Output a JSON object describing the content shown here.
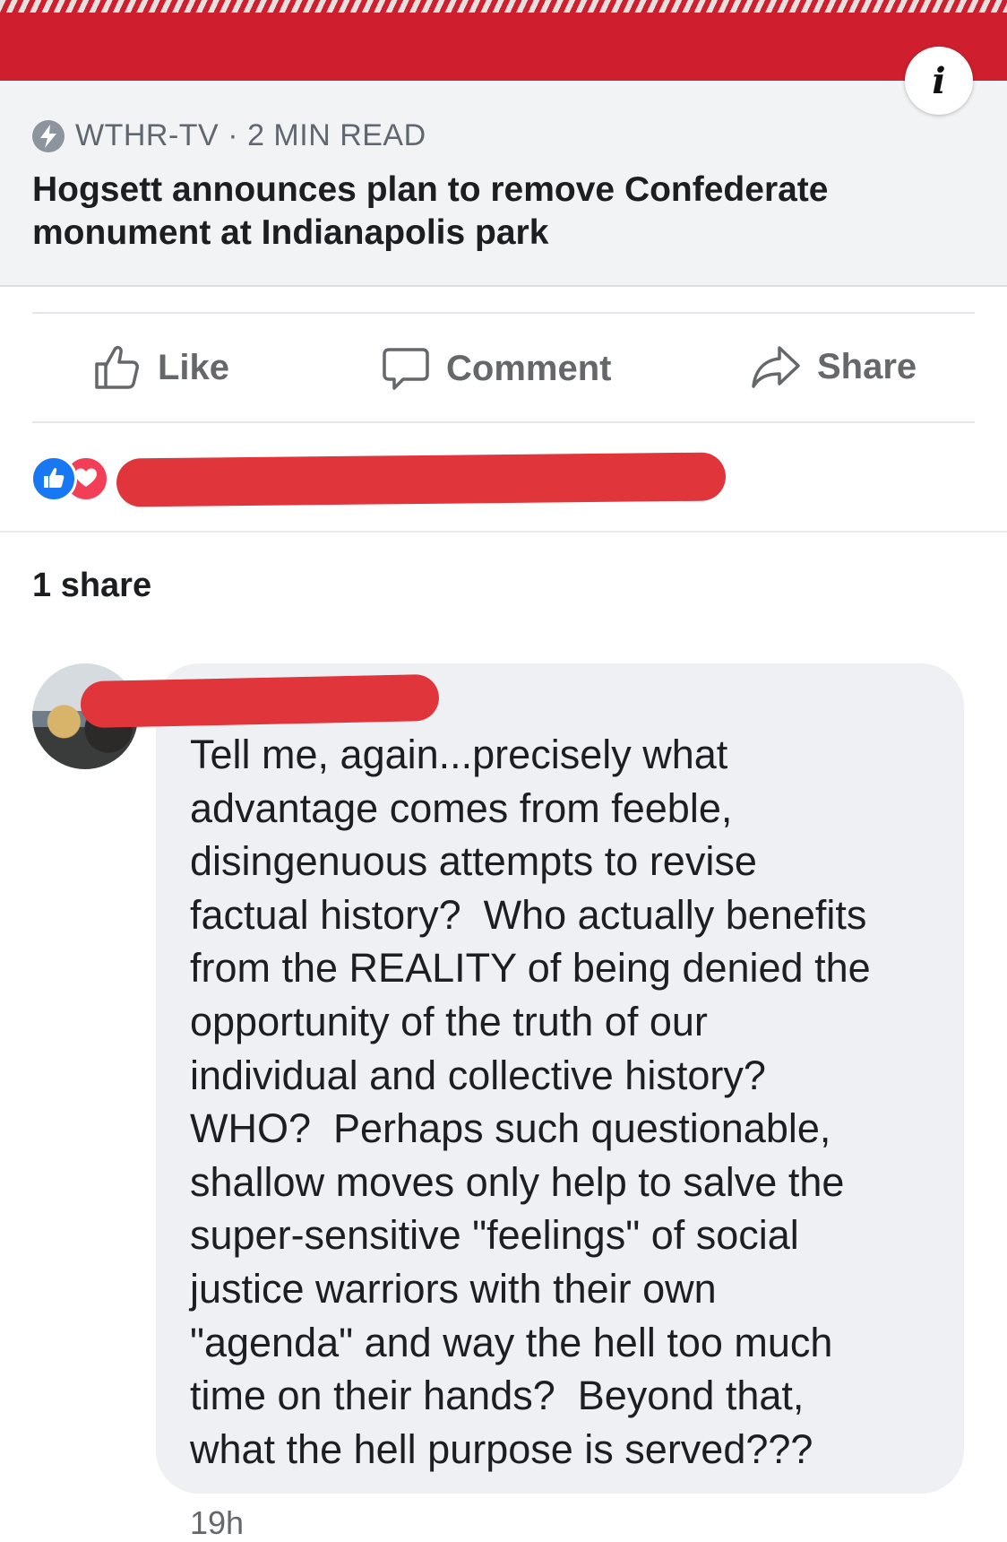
{
  "link_preview": {
    "source": "WTHR-TV",
    "separator": "·",
    "read_time": "2 MIN READ",
    "headline": "Hogsett announces plan to remove Confederate monument at Indianapolis park",
    "info_label": "i"
  },
  "actions": {
    "like": "Like",
    "comment": "Comment",
    "share": "Share"
  },
  "reactions": {
    "types": [
      "like",
      "love"
    ]
  },
  "shares": {
    "label": "1 share"
  },
  "comment": {
    "text": "Tell me, again...precisely what\nadvantage comes from feeble,\ndisingenuous attempts to revise\nfactual history?  Who actually benefits\nfrom the REALITY of being denied the\nopportunity of the truth of our\nindividual and collective history?\nWHO?  Perhaps such questionable,\nshallow moves only help to salve the\nsuper-sensitive \"feelings\" of social\njustice warriors with their own\n\"agenda\" and way the hell too much\ntime on their hands?  Beyond that,\nwhat the hell purpose is served???",
    "timestamp": "19h"
  },
  "colors": {
    "header_red": "#cf1f2e",
    "redaction": "#e0353b",
    "like_blue": "#1877f2",
    "love_red": "#f33e58"
  }
}
